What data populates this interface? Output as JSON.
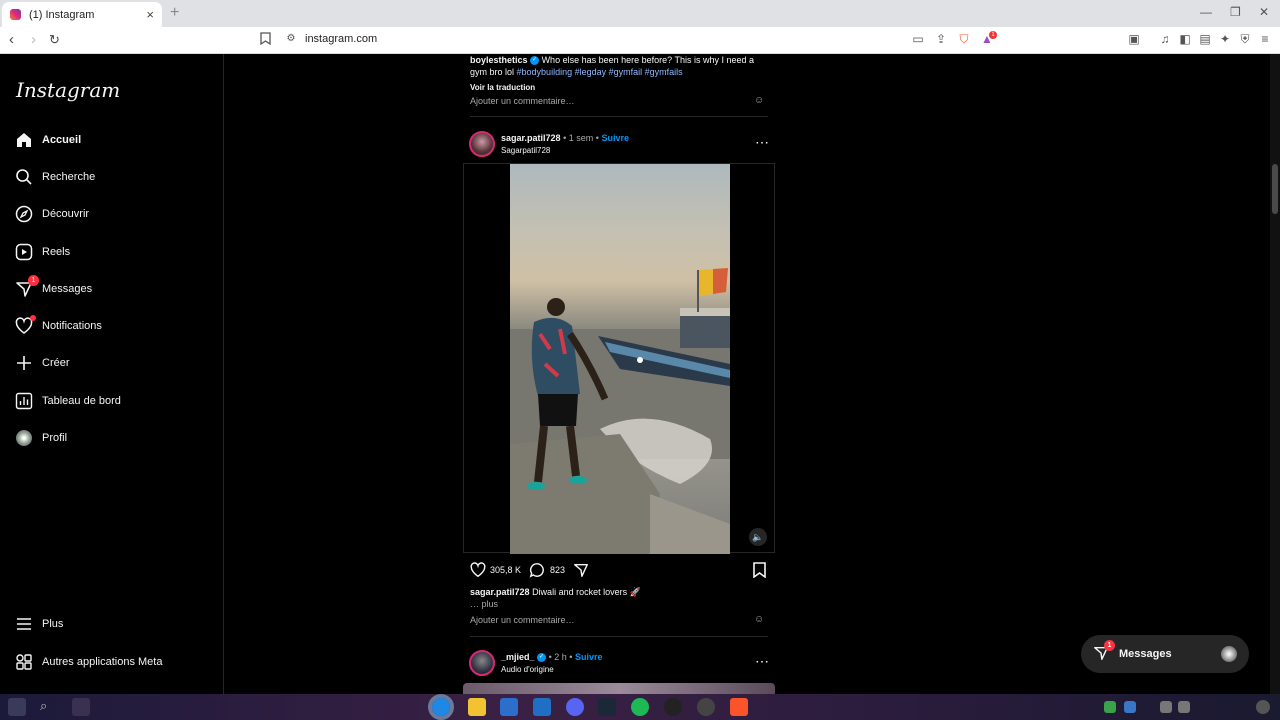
{
  "browser": {
    "tab_title": "(1) Instagram",
    "new_tab": "+",
    "url": "instagram.com",
    "brave_badge": "1"
  },
  "sidebar": {
    "logo": "Instagram",
    "items": [
      {
        "label": "Accueil",
        "icon": "home-icon"
      },
      {
        "label": "Recherche",
        "icon": "search-icon"
      },
      {
        "label": "Découvrir",
        "icon": "compass-icon"
      },
      {
        "label": "Reels",
        "icon": "reels-icon"
      },
      {
        "label": "Messages",
        "icon": "messenger-icon",
        "badge": "1"
      },
      {
        "label": "Notifications",
        "icon": "heart-icon"
      },
      {
        "label": "Créer",
        "icon": "plus-icon"
      },
      {
        "label": "Tableau de bord",
        "icon": "dashboard-icon"
      },
      {
        "label": "Profil",
        "icon": "profile-avatar"
      }
    ],
    "more": "Plus",
    "meta_apps": "Autres applications Meta"
  },
  "prev_post": {
    "username": "boylesthetics",
    "caption": "Who else has been here before? This is why I need a",
    "caption_line2": "gym bro lol",
    "hashtags": "#bodybuilding #legday #gymfail #gymfails",
    "see_translation": "Voir la traduction",
    "comment_placeholder": "Ajouter un commentaire…"
  },
  "post": {
    "username": "sagar.patil728",
    "time": "1 sem",
    "follow": "Suivre",
    "subtitle": "Sagarpatil728",
    "likes": "305,8 K",
    "comments": "823",
    "caption_user": "sagar.patil728",
    "caption": "Diwali and rocket lovers 🚀",
    "more": "… plus",
    "comment_placeholder": "Ajouter un commentaire…"
  },
  "next_post": {
    "username": "_mjied_",
    "time": "2 h",
    "follow": "Suivre",
    "subtitle": "Audio d'origine"
  },
  "messages_pill": {
    "label": "Messages",
    "badge": "1"
  },
  "separator": "•",
  "colors": {
    "accent": "#0095f6",
    "badge": "#ff3040",
    "background": "#000000"
  }
}
